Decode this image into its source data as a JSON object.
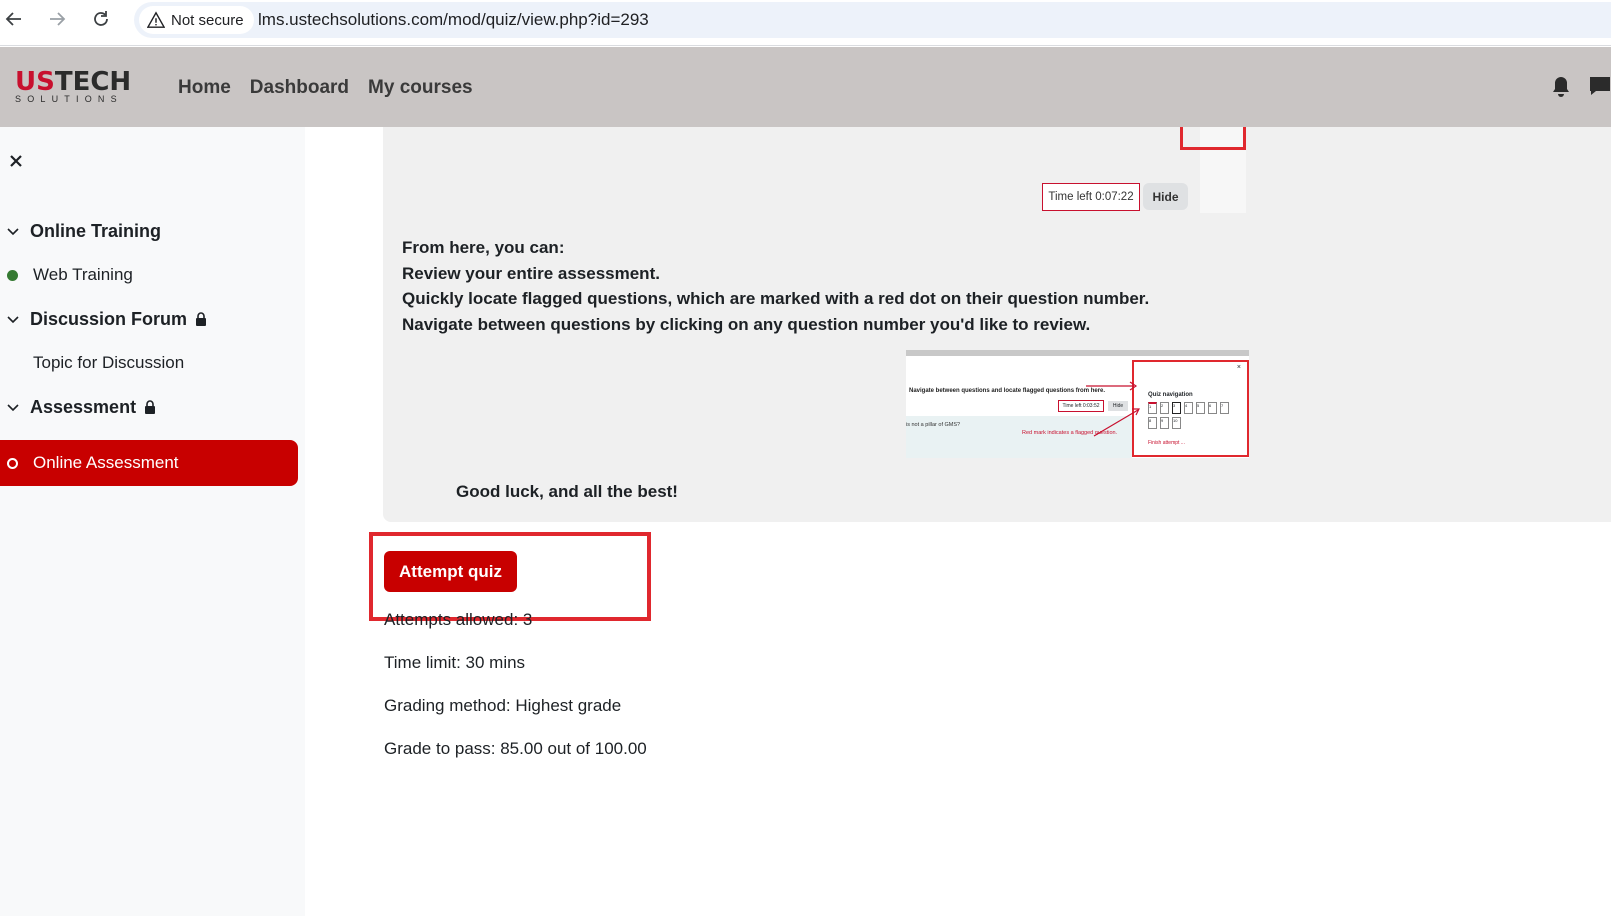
{
  "browser": {
    "security_label": "Not secure",
    "url": "lms.ustechsolutions.com/mod/quiz/view.php?id=293"
  },
  "header": {
    "logo_top_red": "US",
    "logo_top_dark": "TECH",
    "logo_bottom": "SOLUTIONS",
    "nav": [
      "Home",
      "Dashboard",
      "My courses"
    ]
  },
  "sidebar": {
    "sections": [
      {
        "title": "Online Training",
        "locked": false,
        "activities": [
          {
            "title": "Web Training",
            "status": "complete"
          }
        ]
      },
      {
        "title": "Discussion Forum",
        "locked": true,
        "activities": [
          {
            "title": "Topic for Discussion",
            "status": "none"
          }
        ]
      },
      {
        "title": "Assessment",
        "locked": true,
        "activities": [
          {
            "title": "Online Assessment",
            "status": "current"
          }
        ]
      }
    ]
  },
  "intro": {
    "timer_label": "Time left 0:07:22",
    "hide_label": "Hide",
    "lines": [
      "From here, you can:",
      "Review your entire assessment.",
      "Quickly locate flagged questions, which are marked with a red dot on their question number.",
      "Navigate between questions by clicking on any question number you'd like to review."
    ],
    "mini_shot": {
      "heading": "Navigate between questions and locate flagged questions from here.",
      "question_fragment": "is not a pillar of GMS?",
      "flag_note": "Red mark indicates a flagged question.",
      "timer": "Time left 0:03:52",
      "hide": "Hide",
      "nav_title": "Quiz navigation",
      "finish": "Finish attempt ...",
      "close": "×",
      "numbers": [
        "1",
        "2",
        "3",
        "4",
        "5",
        "6",
        "7",
        "8",
        "9",
        "10"
      ]
    },
    "closing": "Good luck, and all the best!"
  },
  "quiz": {
    "attempt_button": "Attempt quiz",
    "attempts_allowed": "Attempts allowed: 3",
    "time_limit": "Time limit: 30 mins",
    "grading_method": "Grading method: Highest grade",
    "grade_to_pass": "Grade to pass: 85.00 out of 100.00"
  },
  "colors": {
    "brand_red": "#c80000",
    "highlight_red": "#e0282e",
    "header_bg": "#c9c5c4",
    "complete_dot": "#357a32"
  }
}
